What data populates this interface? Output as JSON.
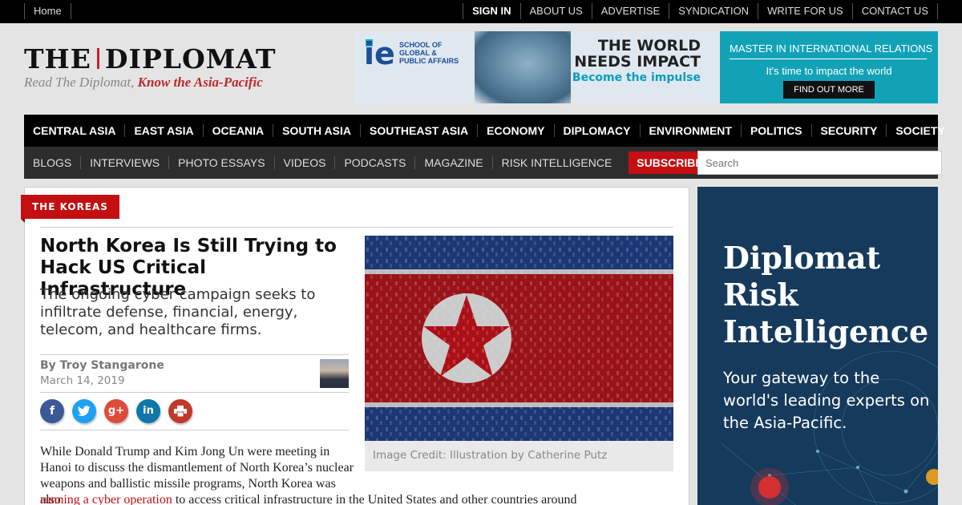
{
  "topbar": {
    "home": "Home",
    "links": [
      "SIGN IN",
      "ABOUT US",
      "ADVERTISE",
      "SYNDICATION",
      "WRITE FOR US",
      "CONTACT US"
    ]
  },
  "logo": {
    "left": "THE",
    "right": "DIPLOMAT",
    "tagline_plain": "Read The Diplomat, ",
    "tagline_bold": "Know the Asia-Pacific"
  },
  "top_ad": {
    "brand": "ie",
    "school": "SCHOOL OF GLOBAL & PUBLIC AFFAIRS",
    "headline": "THE WORLD NEEDS IMPACT",
    "cta_line": "Become the impulse",
    "program": "MASTER IN INTERNATIONAL RELATIONS",
    "pitch": "It's time to impact the world",
    "button": "FIND OUT MORE"
  },
  "nav_primary": [
    "CENTRAL ASIA",
    "EAST ASIA",
    "OCEANIA",
    "SOUTH ASIA",
    "SOUTHEAST ASIA",
    "ECONOMY",
    "DIPLOMACY",
    "ENVIRONMENT",
    "POLITICS",
    "SECURITY",
    "SOCIETY"
  ],
  "nav_secondary": [
    "BLOGS",
    "INTERVIEWS",
    "PHOTO ESSAYS",
    "VIDEOS",
    "PODCASTS",
    "MAGAZINE",
    "RISK INTELLIGENCE"
  ],
  "subscribe": "SUBSCRIBE",
  "search": {
    "placeholder": "Search"
  },
  "article": {
    "category": "THE KOREAS",
    "title": "North Korea Is Still Trying to Hack US Critical Infrastructure",
    "subtitle": "The ongoing cyber campaign seeks to infiltrate defense, financial, energy, telecom, and healthcare firms.",
    "byline": "By Troy Stangarone",
    "date": "March 14, 2019",
    "share_icons": [
      "facebook-icon",
      "twitter-icon",
      "google-plus-icon",
      "linkedin-icon",
      "print-icon"
    ],
    "image_credit": "Image Credit: Illustration by Catherine Putz",
    "body_part1": "While Donald Trump and Kim Jong Un were meeting in Hanoi to discuss the dismantlement of North Korea’s nuclear weapons and ballistic missile programs, North Korea was also",
    "body_link": "running a cyber operation",
    "body_part2": "to access critical infrastructure in the United States and other countries around"
  },
  "side_ad": {
    "headline": "Diplomat Risk Intelligence",
    "text": "Your gateway to the world's leading experts on the Asia-Pacific."
  },
  "colors": {
    "brand_red": "#c40f12",
    "nav_black": "#000000",
    "nav_gray": "#2d2d2d",
    "ad_teal": "#12a2b7",
    "side_ad_blue": "#163a5c"
  }
}
